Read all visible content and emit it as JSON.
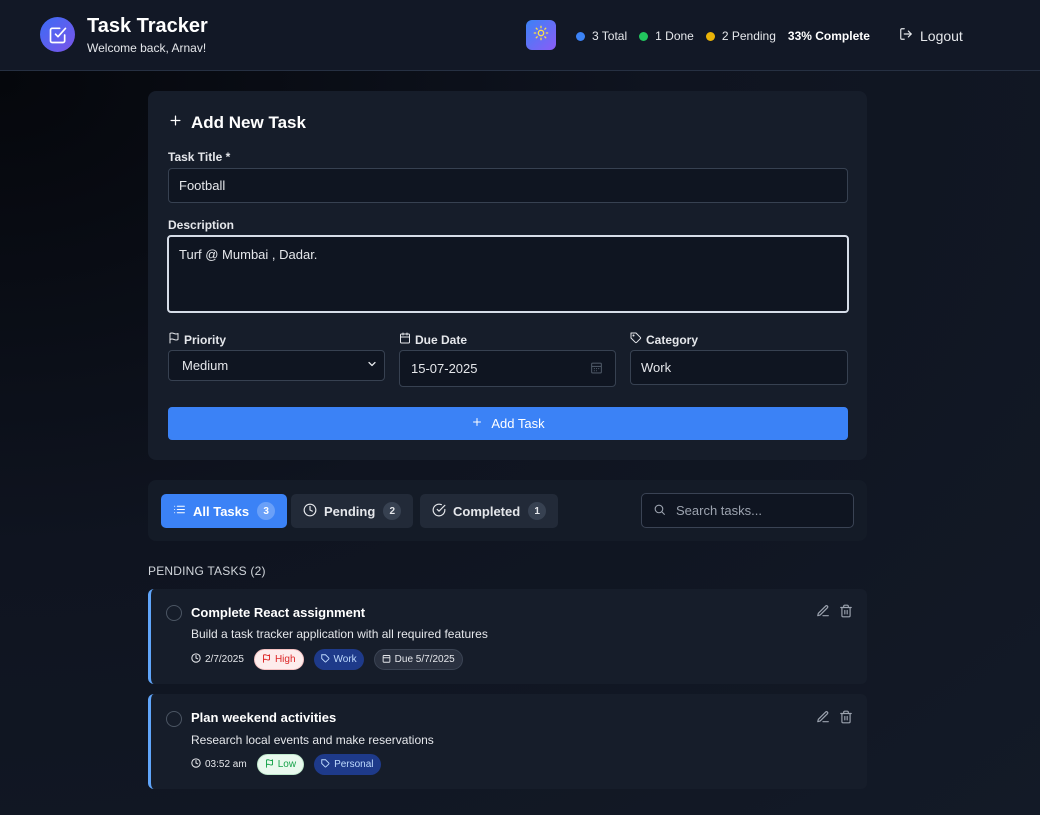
{
  "header": {
    "title": "Task Tracker",
    "welcome": "Welcome back, Arnav!",
    "stats": {
      "total": "3 Total",
      "done": "1 Done",
      "pending": "2 Pending",
      "complete": "33% Complete"
    },
    "logout_label": "Logout"
  },
  "form": {
    "heading": "Add New Task",
    "title_label": "Task Title *",
    "title_value": "Football",
    "description_label": "Description",
    "description_value": "Turf @ Mumbai , Dadar.",
    "priority_label": "Priority",
    "priority_value": "Medium",
    "due_date_label": "Due Date",
    "due_date_value": "15-07-2025",
    "category_label": "Category",
    "category_value": "Work",
    "submit_label": "Add Task"
  },
  "filters": {
    "tabs": [
      {
        "label": "All Tasks",
        "count": "3"
      },
      {
        "label": "Pending",
        "count": "2"
      },
      {
        "label": "Completed",
        "count": "1"
      }
    ],
    "search_placeholder": "Search tasks..."
  },
  "pending_section": {
    "heading": "PENDING TASKS (2)",
    "tasks": [
      {
        "title": "Complete React assignment",
        "description": "Build a task tracker application with all required features",
        "created": "2/7/2025",
        "priority": "High",
        "category": "Work",
        "due": "Due 5/7/2025"
      },
      {
        "title": "Plan weekend activities",
        "description": "Research local events and make reservations",
        "created": "03:52 am",
        "priority": "Low",
        "category": "Personal"
      }
    ]
  },
  "colors": {
    "accent": "#3b82f6",
    "total_dot": "#3b82f6",
    "done_dot": "#22c55e",
    "pending_dot": "#eab308",
    "high_priority": "#dc2626",
    "low_priority": "#16a34a"
  }
}
